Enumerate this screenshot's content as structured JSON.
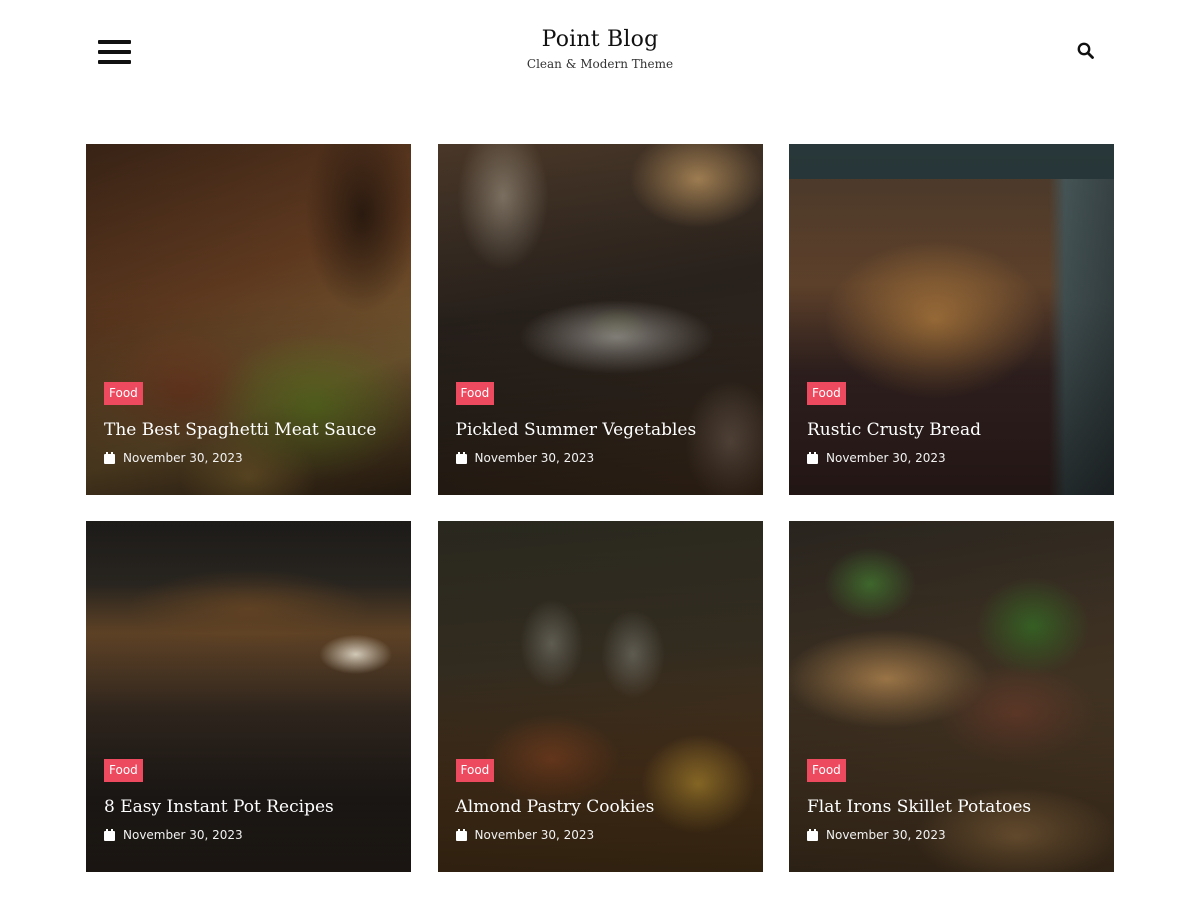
{
  "header": {
    "site_title": "Point Blog",
    "tagline": "Clean & Modern Theme",
    "menu_icon": "hamburger-menu-icon",
    "search_icon": "search-icon"
  },
  "accent_color": "#ee4a5f",
  "posts": [
    {
      "category": "Food",
      "title": "The Best Spaghetti Meat Sauce",
      "date": "November 30, 2023",
      "image": "food platter with meats, olives, peppers and beer bottles"
    },
    {
      "category": "Food",
      "title": "Pickled Summer Vegetables",
      "date": "November 30, 2023",
      "image": "plated dish on restaurant table with glasses"
    },
    {
      "category": "Food",
      "title": "Rustic Crusty Bread",
      "date": "November 30, 2023",
      "image": "overhead view of cafe window at night"
    },
    {
      "category": "Food",
      "title": "8 Easy Instant Pot Recipes",
      "date": "November 30, 2023",
      "image": "restaurant interior with pendant lamp"
    },
    {
      "category": "Food",
      "title": "Almond Pastry Cookies",
      "date": "November 30, 2023",
      "image": "burger and fries with drinks"
    },
    {
      "category": "Food",
      "title": "Flat Irons Skillet Potatoes",
      "date": "November 30, 2023",
      "image": "burgers with basil leaves"
    }
  ]
}
